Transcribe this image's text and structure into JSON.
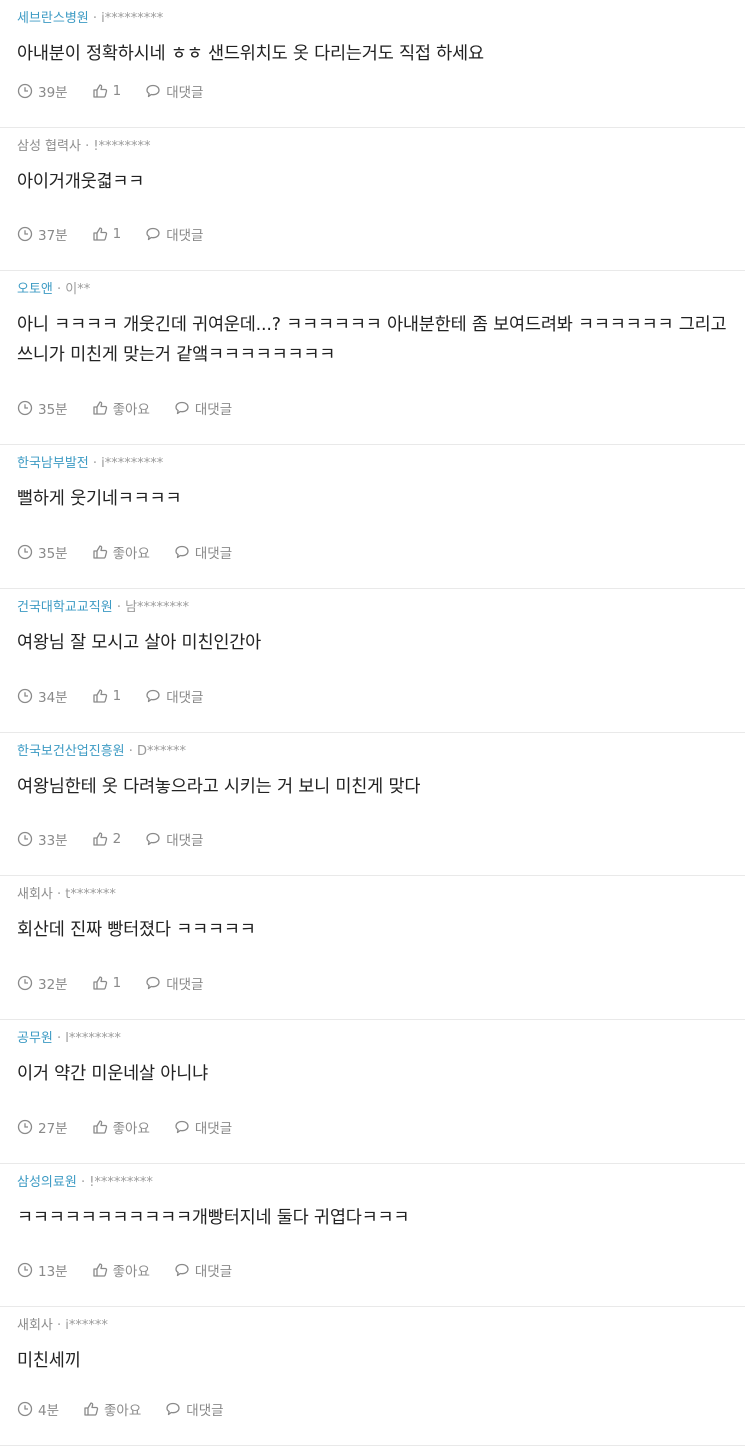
{
  "comments": [
    {
      "company": "세브란스병원",
      "company_style": "blue",
      "user": "i*********",
      "text": "아내분이 정확하시네 ㅎㅎ 샌드위치도 옷 다리는거도 직접 하세요",
      "time": "39분",
      "likes": "1",
      "reply": "대댓글"
    },
    {
      "company": "삼성 협력사",
      "company_style": "gray",
      "user": "!********",
      "text": "아이거개웃겳ㅋㅋ",
      "time": "37분",
      "likes": "1",
      "reply": "대댓글"
    },
    {
      "company": "오토앤",
      "company_style": "blue",
      "user": "이**",
      "text": "아니 ㅋㅋㅋㅋ 개웃긴데 귀여운데...? ㅋㅋㅋㅋㅋㅋ 아내분한테 좀 보여드려봐 ㅋㅋㅋㅋㅋㅋ 그리고 쓰니가 미친게 맞는거 같앸ㅋㅋㅋㅋㅋㅋㅋㅋ",
      "time": "35분",
      "likes": "좋아요",
      "reply": "대댓글"
    },
    {
      "company": "한국남부발전",
      "company_style": "blue",
      "user": "i*********",
      "text": "뻘하게 웃기네ㅋㅋㅋㅋ",
      "time": "35분",
      "likes": "좋아요",
      "reply": "대댓글"
    },
    {
      "company": "건국대학교교직원",
      "company_style": "blue",
      "user": "남********",
      "text": "여왕님 잘 모시고 살아 미친인간아",
      "time": "34분",
      "likes": "1",
      "reply": "대댓글"
    },
    {
      "company": "한국보건산업진흥원",
      "company_style": "blue",
      "user": "D******",
      "text": "여왕님한테 옷 다려놓으라고 시키는 거 보니 미친게 맞다",
      "time": "33분",
      "likes": "2",
      "reply": "대댓글"
    },
    {
      "company": "새회사",
      "company_style": "gray",
      "user": "t*******",
      "text": "회산데 진짜 빵터졌다 ㅋㅋㅋㅋㅋ",
      "time": "32분",
      "likes": "1",
      "reply": "대댓글"
    },
    {
      "company": "공무원",
      "company_style": "blue",
      "user": "l********",
      "text": "이거 약간 미운네살 아니냐",
      "time": "27분",
      "likes": "좋아요",
      "reply": "대댓글"
    },
    {
      "company": "삼성의료원",
      "company_style": "blue",
      "user": "!*********",
      "text": "ㅋㅋㅋㅋㅋㅋㅋㅋㅋㅋㅋ개빵터지네 둘다 귀엽다ㅋㅋㅋ",
      "time": "13분",
      "likes": "좋아요",
      "reply": "대댓글"
    },
    {
      "company": "새회사",
      "company_style": "gray",
      "user": "i******",
      "text": "미친세끼",
      "time": "4분",
      "likes": "좋아요",
      "reply": "대댓글"
    }
  ]
}
